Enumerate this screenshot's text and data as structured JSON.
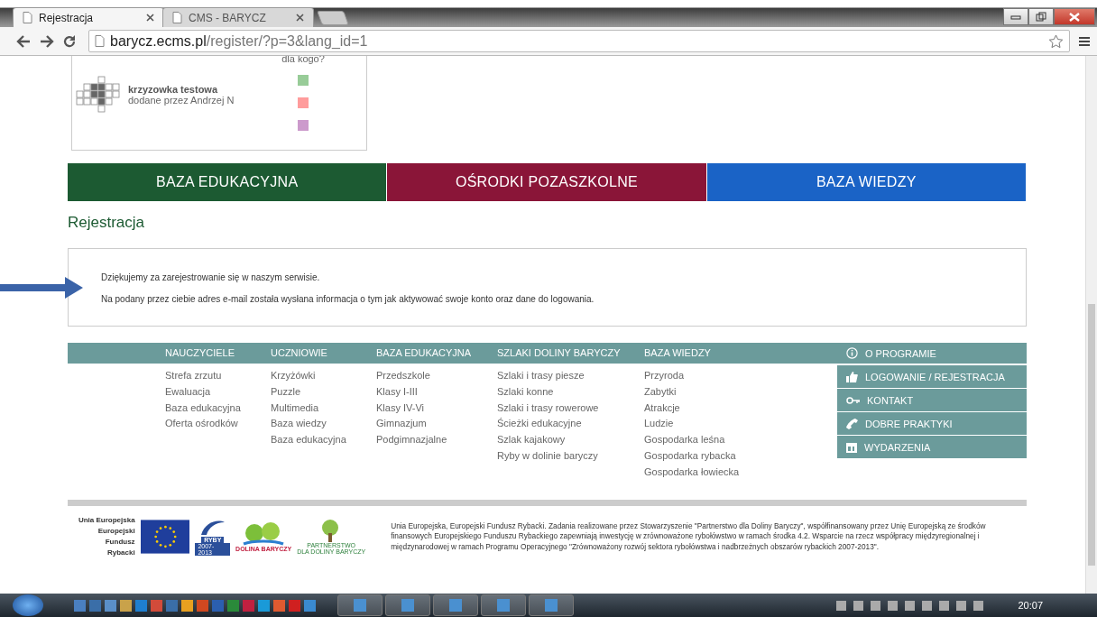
{
  "browser": {
    "tabs": [
      {
        "title": "Rejestracja",
        "selected": true
      },
      {
        "title": "CMS - BARYCZ",
        "selected": false
      }
    ],
    "url_domain": "barycz.ecms.pl",
    "url_path": "/register/?p=3&lang_id=1"
  },
  "crossword_card": {
    "column_heading": "dla kogo?",
    "title": "krzyzowka testowa",
    "author": "dodane przez Andrzej N",
    "audiences": [
      {
        "color": "#98cc98"
      },
      {
        "color": "#ff9c9c"
      },
      {
        "color": "#cc9acc"
      }
    ]
  },
  "main_nav": [
    {
      "label": "BAZA EDUKACYJNA",
      "color": "#1c5a32"
    },
    {
      "label": "OŚRODKI POZASZKOLNE",
      "color": "#8a1538"
    },
    {
      "label": "BAZA WIEDZY",
      "color": "#1a63c6"
    }
  ],
  "page_title": "Rejestracja",
  "messages": [
    "Dziękujemy za zarejestrowanie się w naszym serwisie.",
    "Na podany przez ciebie adres e-mail została wysłana informacja o tym jak aktywować swoje konto oraz dane do logowania."
  ],
  "footer_columns": [
    {
      "heading": "NAUCZYCIELE",
      "links": [
        "Strefa zrzutu",
        "Ewaluacja",
        "Baza edukacyjna",
        "Oferta ośrodków"
      ]
    },
    {
      "heading": "UCZNIOWIE",
      "links": [
        "Krzyżówki",
        "Puzzle",
        "Multimedia",
        "Baza wiedzy",
        "Baza edukacyjna"
      ]
    },
    {
      "heading": "BAZA EDUKACYJNA",
      "links": [
        "Przedszkole",
        "Klasy I-III",
        "Klasy IV-Vi",
        "Gimnazjum",
        "Podgimnazjalne"
      ]
    },
    {
      "heading": "SZLAKI DOLINY BARYCZY",
      "links": [
        "Szlaki i trasy piesze",
        "Szlaki konne",
        "Szlaki i trasy rowerowe",
        "Ścieżki edukacyjne",
        "Szlak kajakowy",
        "Ryby w dolinie baryczy"
      ]
    },
    {
      "heading": "BAZA WIEDZY",
      "links": [
        "Przyroda",
        "Zabytki",
        "Atrakcje",
        "Ludzie",
        "Gospodarka leśna",
        "Gospodarka rybacka",
        "Gospodarka łowiecka"
      ]
    }
  ],
  "footer_menu": [
    {
      "label": "O PROGRAMIE",
      "kind": "info"
    },
    {
      "label": "LOGOWANIE / REJESTRACJA",
      "kind": "thumb"
    },
    {
      "label": "KONTAKT",
      "kind": "key"
    },
    {
      "label": "DOBRE PRAKTYKI",
      "kind": "phone"
    },
    {
      "label": "WYDARZENIA",
      "kind": "calendar"
    }
  ],
  "sponsors": {
    "eu_lines": [
      "Unia Europejska",
      "Europejski",
      "Fundusz Rybacki"
    ],
    "ryby_label": "RYBY",
    "ryby_years": "2007-2013",
    "dolina_label": "DOLINA BARYCZY",
    "partnerstwo_label": "PARTNERSTWO",
    "partnerstwo_sub": "DLA DOLINY BARYCZY",
    "funding_text": "Unia Europejska, Europejski Fundusz Rybacki. Zadania realizowane przez Stowarzyszenie \"Partnerstwo dla Doliny Baryczy\", współfinansowany przez Unię Europejską ze środków finansowych Europejskiego Funduszu Rybackiego zapewniają inwestycję w zrównoważone rybołówstwo w ramach środka 4.2. Wsparcie na rzecz współpracy międzyregionalnej i międzynarodowej w ramach Programu Operacyjnego \"Zrównoważony rozwój sektora rybołówstwa i nadbrzeżnych obszarów rybackich 2007-2013\"."
  },
  "taskbar": {
    "clock": "20:07"
  }
}
